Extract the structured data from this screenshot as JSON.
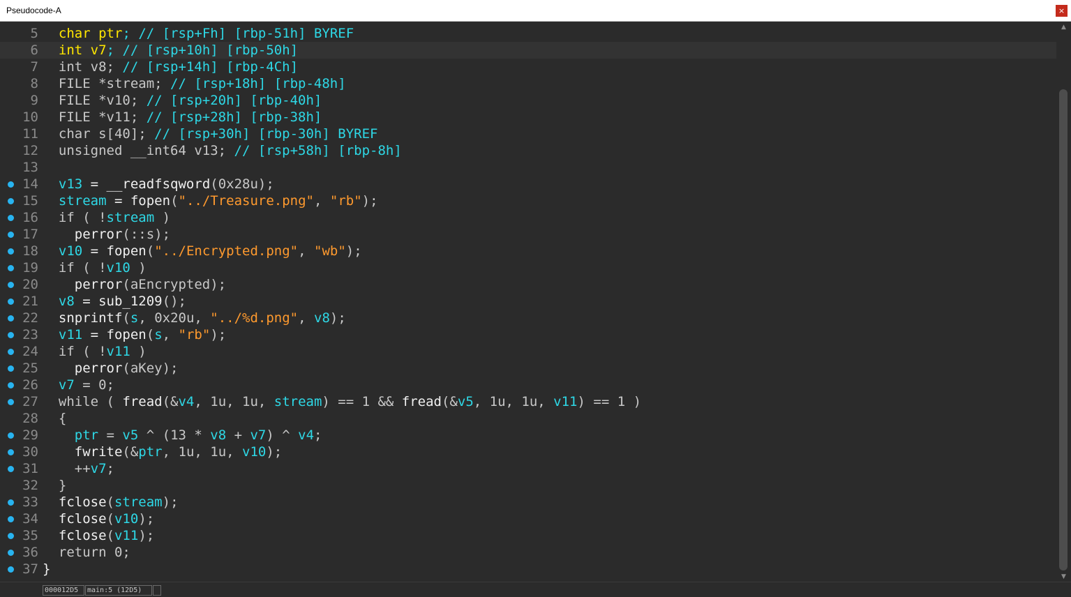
{
  "window": {
    "title": "Pseudocode-A",
    "close_label": "×"
  },
  "editor": {
    "current_line": 6,
    "lines": [
      {
        "n": "5",
        "bp": false,
        "tokens": [
          [
            "  ",
            "c-plain"
          ],
          [
            "char",
            "c-yellow"
          ],
          [
            " ",
            "c-plain"
          ],
          [
            "ptr",
            "c-yellow"
          ],
          [
            "; // [rsp+Fh] [rbp-51h] BYREF",
            "c-var"
          ]
        ]
      },
      {
        "n": "6",
        "bp": false,
        "tokens": [
          [
            "  ",
            "c-plain"
          ],
          [
            "int",
            "c-yellow"
          ],
          [
            " ",
            "c-plain"
          ],
          [
            "v7",
            "c-yellow"
          ],
          [
            "; // [rsp+10h] [rbp-50h]",
            "c-var"
          ]
        ]
      },
      {
        "n": "7",
        "bp": false,
        "tokens": [
          [
            "  int v8; ",
            "c-plain"
          ],
          [
            "// [rsp+14h] [rbp-4Ch]",
            "c-var"
          ]
        ]
      },
      {
        "n": "8",
        "bp": false,
        "tokens": [
          [
            "  FILE *stream; ",
            "c-plain"
          ],
          [
            "// [rsp+18h] [rbp-48h]",
            "c-var"
          ]
        ]
      },
      {
        "n": "9",
        "bp": false,
        "tokens": [
          [
            "  FILE *v10; ",
            "c-plain"
          ],
          [
            "// [rsp+20h] [rbp-40h]",
            "c-var"
          ]
        ]
      },
      {
        "n": "10",
        "bp": false,
        "tokens": [
          [
            "  FILE *v11; ",
            "c-plain"
          ],
          [
            "// [rsp+28h] [rbp-38h]",
            "c-var"
          ]
        ]
      },
      {
        "n": "11",
        "bp": false,
        "tokens": [
          [
            "  char s[40]; ",
            "c-plain"
          ],
          [
            "// [rsp+30h] [rbp-30h] BYREF",
            "c-var"
          ]
        ]
      },
      {
        "n": "12",
        "bp": false,
        "tokens": [
          [
            "  unsigned __int64 v13; ",
            "c-plain"
          ],
          [
            "// [rsp+58h] [rbp-8h]",
            "c-var"
          ]
        ]
      },
      {
        "n": "13",
        "bp": false,
        "tokens": [
          [
            "",
            "c-plain"
          ]
        ]
      },
      {
        "n": "14",
        "bp": true,
        "tokens": [
          [
            "  ",
            "c-plain"
          ],
          [
            "v13",
            "c-var"
          ],
          [
            " = ",
            "c-func"
          ],
          [
            "__readfsqword",
            "c-func"
          ],
          [
            "(0x28u);",
            "c-plain"
          ]
        ]
      },
      {
        "n": "15",
        "bp": true,
        "tokens": [
          [
            "  ",
            "c-plain"
          ],
          [
            "stream",
            "c-var"
          ],
          [
            " = ",
            "c-func"
          ],
          [
            "fopen",
            "c-func"
          ],
          [
            "(",
            "c-plain"
          ],
          [
            "\"../Treasure.png\"",
            "c-str"
          ],
          [
            ", ",
            "c-plain"
          ],
          [
            "\"rb\"",
            "c-str"
          ],
          [
            ");",
            "c-plain"
          ]
        ]
      },
      {
        "n": "16",
        "bp": true,
        "tokens": [
          [
            "  if ( !",
            "c-plain"
          ],
          [
            "stream",
            "c-var"
          ],
          [
            " )",
            "c-plain"
          ]
        ]
      },
      {
        "n": "17",
        "bp": true,
        "tokens": [
          [
            "    ",
            "c-plain"
          ],
          [
            "perror",
            "c-func"
          ],
          [
            "(::s);",
            "c-plain"
          ]
        ]
      },
      {
        "n": "18",
        "bp": true,
        "tokens": [
          [
            "  ",
            "c-plain"
          ],
          [
            "v10",
            "c-var"
          ],
          [
            " = ",
            "c-func"
          ],
          [
            "fopen",
            "c-func"
          ],
          [
            "(",
            "c-plain"
          ],
          [
            "\"../Encrypted.png\"",
            "c-str"
          ],
          [
            ", ",
            "c-plain"
          ],
          [
            "\"wb\"",
            "c-str"
          ],
          [
            ");",
            "c-plain"
          ]
        ]
      },
      {
        "n": "19",
        "bp": true,
        "tokens": [
          [
            "  if ( !",
            "c-plain"
          ],
          [
            "v10",
            "c-var"
          ],
          [
            " )",
            "c-plain"
          ]
        ]
      },
      {
        "n": "20",
        "bp": true,
        "tokens": [
          [
            "    ",
            "c-plain"
          ],
          [
            "perror",
            "c-func"
          ],
          [
            "(aEncrypted);",
            "c-plain"
          ]
        ]
      },
      {
        "n": "21",
        "bp": true,
        "tokens": [
          [
            "  ",
            "c-plain"
          ],
          [
            "v8",
            "c-var"
          ],
          [
            " = ",
            "c-func"
          ],
          [
            "sub_1209",
            "c-func"
          ],
          [
            "();",
            "c-plain"
          ]
        ]
      },
      {
        "n": "22",
        "bp": true,
        "tokens": [
          [
            "  ",
            "c-plain"
          ],
          [
            "snprintf",
            "c-func"
          ],
          [
            "(",
            "c-plain"
          ],
          [
            "s",
            "c-var"
          ],
          [
            ", 0x20u, ",
            "c-plain"
          ],
          [
            "\"../%d.png\"",
            "c-str"
          ],
          [
            ", ",
            "c-plain"
          ],
          [
            "v8",
            "c-var"
          ],
          [
            ");",
            "c-plain"
          ]
        ]
      },
      {
        "n": "23",
        "bp": true,
        "tokens": [
          [
            "  ",
            "c-plain"
          ],
          [
            "v11",
            "c-var"
          ],
          [
            " = ",
            "c-func"
          ],
          [
            "fopen",
            "c-func"
          ],
          [
            "(",
            "c-plain"
          ],
          [
            "s",
            "c-var"
          ],
          [
            ", ",
            "c-plain"
          ],
          [
            "\"rb\"",
            "c-str"
          ],
          [
            ");",
            "c-plain"
          ]
        ]
      },
      {
        "n": "24",
        "bp": true,
        "tokens": [
          [
            "  if ( !",
            "c-plain"
          ],
          [
            "v11",
            "c-var"
          ],
          [
            " )",
            "c-plain"
          ]
        ]
      },
      {
        "n": "25",
        "bp": true,
        "tokens": [
          [
            "    ",
            "c-plain"
          ],
          [
            "perror",
            "c-func"
          ],
          [
            "(aKey);",
            "c-plain"
          ]
        ]
      },
      {
        "n": "26",
        "bp": true,
        "tokens": [
          [
            "  ",
            "c-plain"
          ],
          [
            "v7",
            "c-var"
          ],
          [
            " = 0;",
            "c-plain"
          ]
        ]
      },
      {
        "n": "27",
        "bp": true,
        "tokens": [
          [
            "  while ( ",
            "c-plain"
          ],
          [
            "fread",
            "c-func"
          ],
          [
            "(&",
            "c-plain"
          ],
          [
            "v4",
            "c-var"
          ],
          [
            ", 1u, 1u, ",
            "c-plain"
          ],
          [
            "stream",
            "c-var"
          ],
          [
            ") == 1 && ",
            "c-plain"
          ],
          [
            "fread",
            "c-func"
          ],
          [
            "(&",
            "c-plain"
          ],
          [
            "v5",
            "c-var"
          ],
          [
            ", 1u, 1u, ",
            "c-plain"
          ],
          [
            "v11",
            "c-var"
          ],
          [
            ") == 1 )",
            "c-plain"
          ]
        ]
      },
      {
        "n": "28",
        "bp": false,
        "tokens": [
          [
            "  {",
            "c-plain"
          ]
        ]
      },
      {
        "n": "29",
        "bp": true,
        "tokens": [
          [
            "    ",
            "c-plain"
          ],
          [
            "ptr",
            "c-var"
          ],
          [
            " = ",
            "c-plain"
          ],
          [
            "v5",
            "c-var"
          ],
          [
            " ^ (13 * ",
            "c-plain"
          ],
          [
            "v8",
            "c-var"
          ],
          [
            " + ",
            "c-plain"
          ],
          [
            "v7",
            "c-var"
          ],
          [
            ") ^ ",
            "c-plain"
          ],
          [
            "v4",
            "c-var"
          ],
          [
            ";",
            "c-plain"
          ]
        ]
      },
      {
        "n": "30",
        "bp": true,
        "tokens": [
          [
            "    ",
            "c-plain"
          ],
          [
            "fwrite",
            "c-func"
          ],
          [
            "(&",
            "c-plain"
          ],
          [
            "ptr",
            "c-var"
          ],
          [
            ", 1u, 1u, ",
            "c-plain"
          ],
          [
            "v10",
            "c-var"
          ],
          [
            ");",
            "c-plain"
          ]
        ]
      },
      {
        "n": "31",
        "bp": true,
        "tokens": [
          [
            "    ++",
            "c-plain"
          ],
          [
            "v7",
            "c-var"
          ],
          [
            ";",
            "c-plain"
          ]
        ]
      },
      {
        "n": "32",
        "bp": false,
        "tokens": [
          [
            "  }",
            "c-plain"
          ]
        ]
      },
      {
        "n": "33",
        "bp": true,
        "tokens": [
          [
            "  ",
            "c-plain"
          ],
          [
            "fclose",
            "c-func"
          ],
          [
            "(",
            "c-plain"
          ],
          [
            "stream",
            "c-var"
          ],
          [
            ");",
            "c-plain"
          ]
        ]
      },
      {
        "n": "34",
        "bp": true,
        "tokens": [
          [
            "  ",
            "c-plain"
          ],
          [
            "fclose",
            "c-func"
          ],
          [
            "(",
            "c-plain"
          ],
          [
            "v10",
            "c-var"
          ],
          [
            ");",
            "c-plain"
          ]
        ]
      },
      {
        "n": "35",
        "bp": true,
        "tokens": [
          [
            "  ",
            "c-plain"
          ],
          [
            "fclose",
            "c-func"
          ],
          [
            "(",
            "c-plain"
          ],
          [
            "v11",
            "c-var"
          ],
          [
            ");",
            "c-plain"
          ]
        ]
      },
      {
        "n": "36",
        "bp": true,
        "tokens": [
          [
            "  return 0;",
            "c-plain"
          ]
        ]
      },
      {
        "n": "37",
        "bp": true,
        "tokens": [
          [
            "}",
            "c-func"
          ]
        ]
      }
    ]
  },
  "statusbar": {
    "address": "000012D5",
    "location": "main:5 (12D5)",
    "extra": ""
  },
  "colors": {
    "background": "#2b2b2b",
    "breakpoint": "#28b4f0",
    "variable": "#2ed8e6",
    "string": "#ff9a2e",
    "declaration": "#ffe600"
  },
  "icons": {
    "close": "close-icon",
    "scroll_up": "chevron-up-icon",
    "scroll_down": "chevron-down-icon"
  }
}
